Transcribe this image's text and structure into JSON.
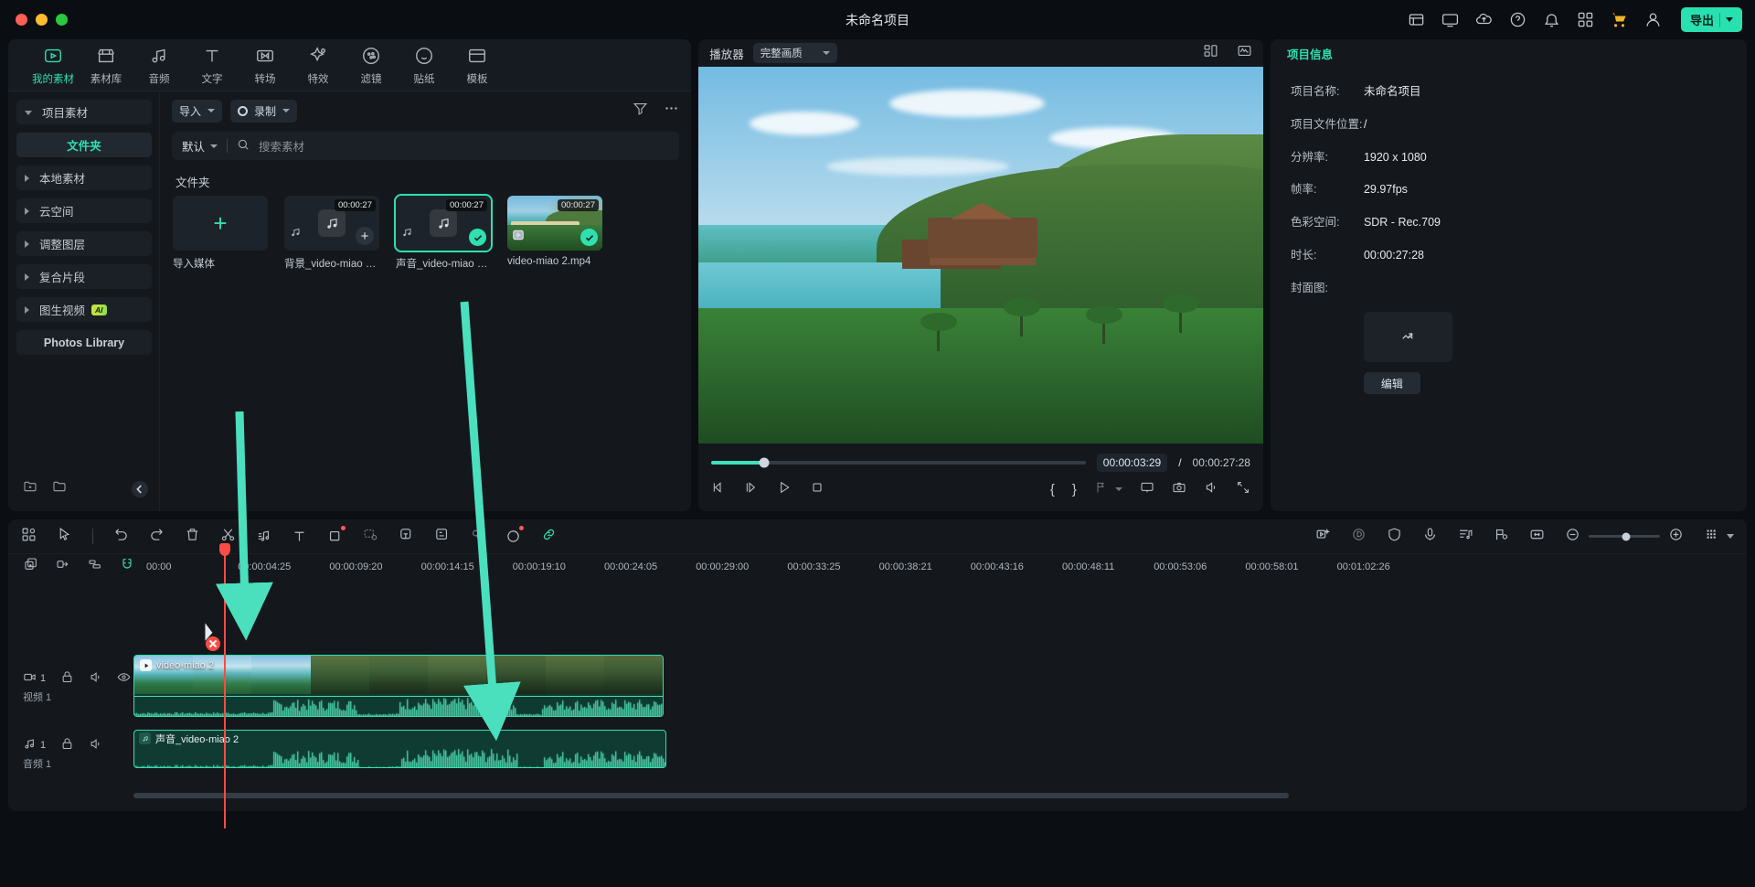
{
  "titlebar": {
    "project_title": "未命名项目",
    "export_label": "导出",
    "icons": [
      "grid-apps-icon",
      "monitor-icon",
      "cloud-upload-icon",
      "help-circle-icon",
      "bell-icon",
      "apps-menu-icon",
      "cart-icon",
      "user-avatar-icon"
    ]
  },
  "library": {
    "tabs": [
      {
        "label": "我的素材",
        "icon": "media-play-frame-icon",
        "active": true
      },
      {
        "label": "素材库",
        "icon": "store-icon",
        "active": false
      },
      {
        "label": "音频",
        "icon": "music-note-icon",
        "active": false
      },
      {
        "label": "文字",
        "icon": "text-t-icon",
        "active": false
      },
      {
        "label": "转场",
        "icon": "transition-icon",
        "active": false
      },
      {
        "label": "特效",
        "icon": "effects-star-icon",
        "active": false
      },
      {
        "label": "滤镜",
        "icon": "filter-circle-icon",
        "active": false
      },
      {
        "label": "贴纸",
        "icon": "sticker-icon",
        "active": false
      },
      {
        "label": "模板",
        "icon": "template-icon",
        "active": false
      }
    ],
    "sidebar": [
      {
        "label": "项目素材",
        "type": "group-open"
      },
      {
        "label": "文件夹",
        "type": "sub-active"
      },
      {
        "label": "本地素材",
        "type": "group"
      },
      {
        "label": "云空间",
        "type": "group"
      },
      {
        "label": "调整图层",
        "type": "group"
      },
      {
        "label": "复合片段",
        "type": "group",
        "badge": ""
      },
      {
        "label": "图生视频",
        "type": "group",
        "badge": "AI"
      },
      {
        "label": "Photos Library",
        "type": "plainbold"
      }
    ],
    "toolbar": {
      "import_label": "导入",
      "record_label": "录制",
      "filter_icon": "filter-icon",
      "more_icon": "more-horizontal-icon"
    },
    "search": {
      "sort_label": "默认",
      "placeholder": "搜索素材",
      "search_icon": "search-icon"
    },
    "section_title": "文件夹",
    "items": [
      {
        "name": "导入媒体",
        "type": "import",
        "duration": ""
      },
      {
        "name": "背景_video-miao 2.m...",
        "type": "audio",
        "duration": "00:00:27",
        "selected": false,
        "add": true
      },
      {
        "name": "声音_video-miao 2.m...",
        "type": "audio",
        "duration": "00:00:27",
        "selected": true,
        "add": false
      },
      {
        "name": "video-miao 2.mp4",
        "type": "video",
        "duration": "00:00:27",
        "selected": true,
        "add": false
      }
    ]
  },
  "player": {
    "label": "播放器",
    "quality": "完整画质",
    "layout_icon": "layout-grid-icon",
    "scope_icon": "waveform-scope-icon",
    "current_time": "00:00:03:29",
    "separator": "/",
    "total_time": "00:00:27:28",
    "progress_percent": 14,
    "controls": [
      "prev-frame-icon",
      "next-frame-icon",
      "play-icon",
      "stop-icon"
    ],
    "right_controls": [
      "mark-in-brace",
      "mark-out-brace",
      "marker-icon",
      "chevron-down-icon",
      "screen-icon",
      "snapshot-camera-icon",
      "volume-icon",
      "fullscreen-icon"
    ],
    "mark_in": "{",
    "mark_out": "}"
  },
  "inspector": {
    "tab": "项目信息",
    "rows": [
      {
        "key": "项目名称:",
        "value": "未命名项目"
      },
      {
        "key": "项目文件位置:",
        "value": "/"
      },
      {
        "key": "分辨率:",
        "value": "1920 x 1080"
      },
      {
        "key": "帧率:",
        "value": "29.97fps"
      },
      {
        "key": "色彩空间:",
        "value": "SDR - Rec.709"
      },
      {
        "key": "时长:",
        "value": "00:00:27:28"
      },
      {
        "key": "封面图:",
        "value": ""
      }
    ],
    "cover_icon": "image-expand-icon",
    "edit_label": "编辑"
  },
  "timeline": {
    "toolbar_left": [
      "grid-view-icon",
      "pointer-select-icon",
      "undo-icon",
      "redo-icon",
      "delete-trash-icon",
      "split-scissors-icon",
      "audio-detach-icon",
      "text-tool-icon",
      "crop-tool-icon",
      "mask-tool-icon",
      "sticker-track-icon",
      "auto-caption-icon",
      "keyframe-icon",
      "ai-tool-icon",
      "link-chain-icon"
    ],
    "toolbar_right": [
      "smart-cutout-icon",
      "speed-icon",
      "shield-icon",
      "voice-record-icon",
      "audio-mixer-icon",
      "marker-flag-icon",
      "fit-width-icon",
      "zoom-out-icon",
      "zoom-in-icon",
      "track-height-icon",
      "chevron-down-icon"
    ],
    "zoom_level_percent": 52,
    "ruler_tools": [
      "add-track-icon",
      "link-clip-icon",
      "group-icon",
      "magnet-snap-icon"
    ],
    "ticks": [
      "00:00",
      "00:00:04:25",
      "00:00:09:20",
      "00:00:14:15",
      "00:00:19:10",
      "00:00:24:05",
      "00:00:29:00",
      "00:00:33:25",
      "00:00:38:21",
      "00:00:43:16",
      "00:00:48:11",
      "00:00:53:06",
      "00:00:58:01",
      "00:01:02:26"
    ],
    "tracks": [
      {
        "index": "1",
        "kind": "video",
        "name": "视频 1",
        "clip_label": "video-miao 2",
        "controls": [
          "camera-icon",
          "lock-icon",
          "mute-icon",
          "eye-icon"
        ]
      },
      {
        "index": "1",
        "kind": "audio",
        "name": "音频 1",
        "clip_label": "声音_video-miao 2",
        "controls": [
          "music-icon",
          "lock-icon",
          "mute-icon"
        ]
      }
    ],
    "playhead_time": "00:00:04:25"
  },
  "annotations": {
    "arrows": 2,
    "cursor_badge": "delete-cursor-badge"
  },
  "colors": {
    "accent": "#2fe0b0",
    "export": "#28e0b0",
    "playhead": "#ff4b43",
    "panel": "#14181d",
    "bg": "#0b0e12",
    "arrow": "#4ae0bd"
  }
}
